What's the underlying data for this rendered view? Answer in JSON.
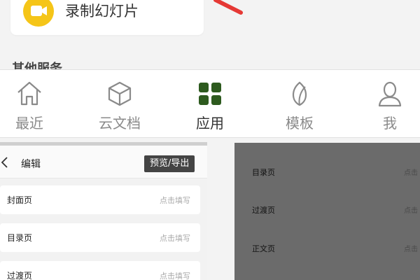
{
  "top": {
    "record_label": "录制幻灯片",
    "other_services_label": "其他服务"
  },
  "nav": {
    "items": [
      {
        "label": "最近",
        "icon": "home-icon",
        "active": false
      },
      {
        "label": "云文档",
        "icon": "cube-icon",
        "active": false
      },
      {
        "label": "应用",
        "icon": "apps-grid-icon",
        "active": true
      },
      {
        "label": "模板",
        "icon": "leaf-icon",
        "active": false
      },
      {
        "label": "我",
        "icon": "person-icon",
        "active": false
      }
    ],
    "active_color": "#2d5a1e"
  },
  "editor": {
    "title": "编辑",
    "preview_export_label": "预览/导出",
    "pages": [
      {
        "name": "封面页",
        "hint": "点击填写"
      },
      {
        "name": "目录页",
        "hint": "点击填写"
      },
      {
        "name": "过渡页",
        "hint": "点击填写"
      }
    ]
  },
  "overlay": {
    "pages": [
      {
        "name": "目录页",
        "hint": "点击"
      },
      {
        "name": "过渡页",
        "hint": "点击"
      },
      {
        "name": "正文页",
        "hint": "点击"
      }
    ]
  },
  "colors": {
    "record_icon": "#f5c518",
    "annotation_arrow": "#e53935",
    "overlay_dim": "#6b6b6b"
  }
}
